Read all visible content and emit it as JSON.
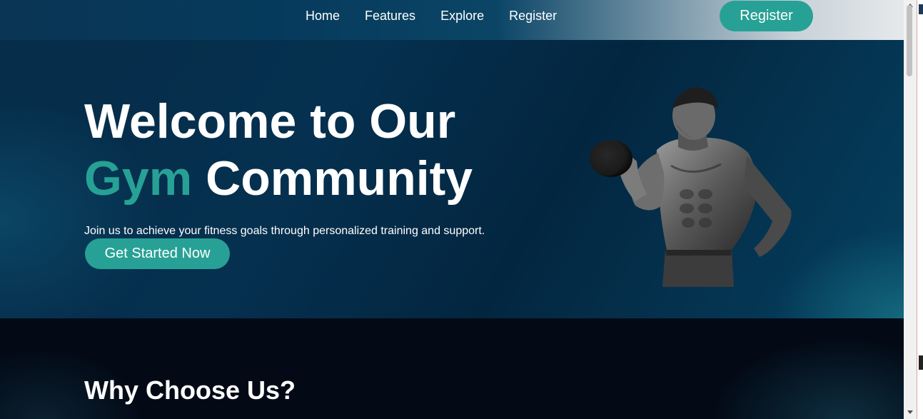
{
  "nav": {
    "links": [
      {
        "label": "Home"
      },
      {
        "label": "Features"
      },
      {
        "label": "Explore"
      },
      {
        "label": "Register"
      }
    ],
    "cta_label": "Register"
  },
  "hero": {
    "title_line1": "Welcome to Our",
    "title_accent": "Gym",
    "title_rest": " Community",
    "subtitle": "Join us to achieve your fitness goals through personalized training and support.",
    "cta_label": "Get Started Now",
    "image": "bodybuilder-with-dumbbell"
  },
  "why": {
    "heading": "Why Choose Us?"
  },
  "colors": {
    "accent": "#27a195",
    "hero_bg": "#05304f",
    "section_bg": "#030a16",
    "text": "#ffffff"
  }
}
